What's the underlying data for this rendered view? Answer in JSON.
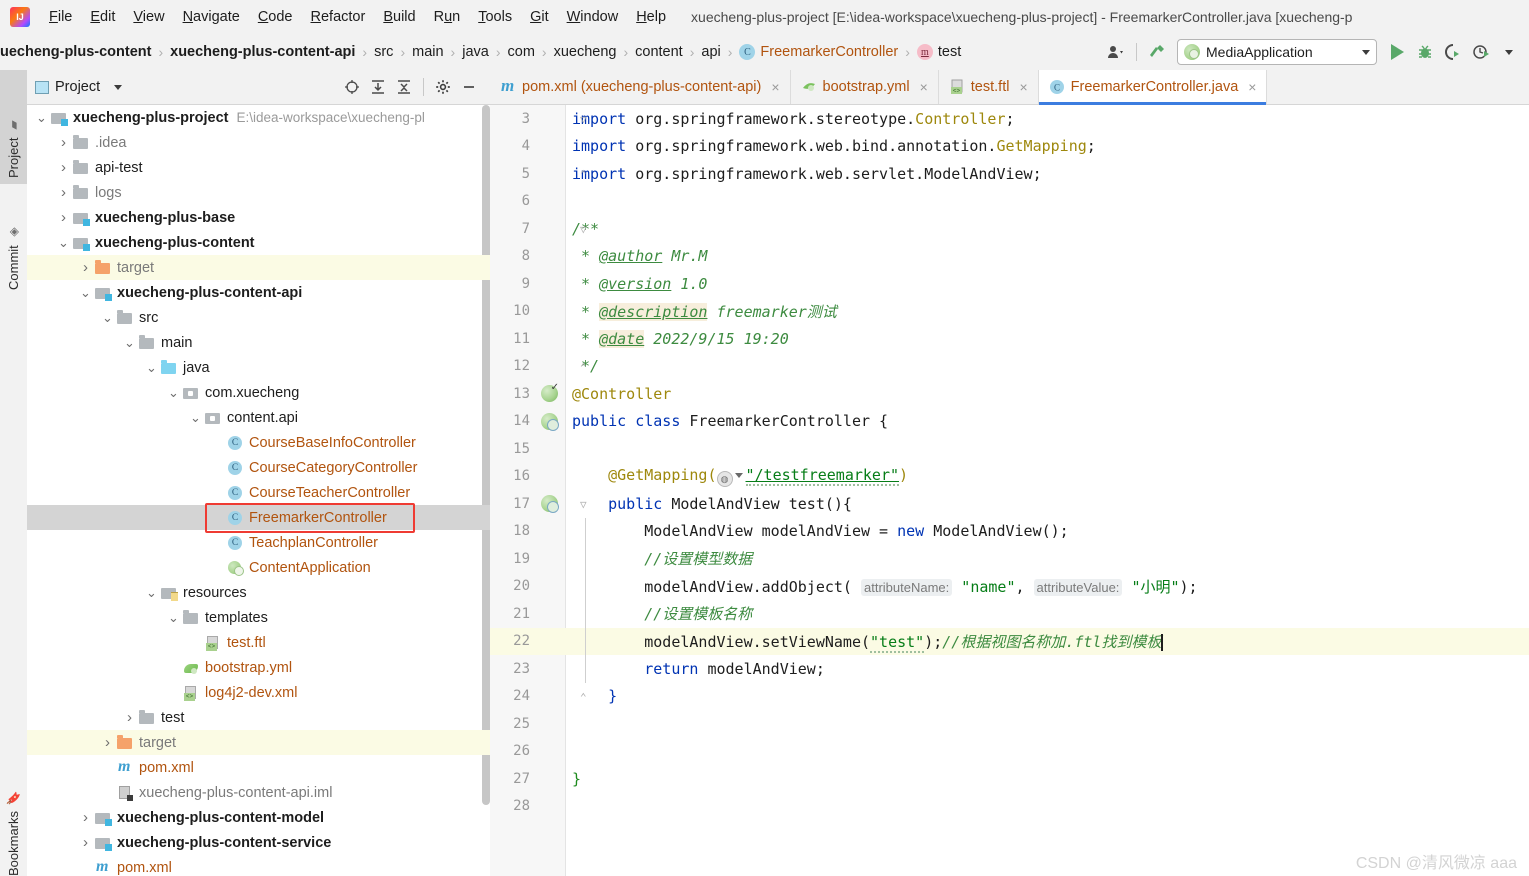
{
  "window": {
    "title": "xuecheng-plus-project [E:\\idea-workspace\\xuecheng-plus-project] - FreemarkerController.java [xuecheng-p",
    "logo_label": "intellij-idea-logo"
  },
  "menubar": {
    "items": [
      {
        "label": "File",
        "mnemonic": "F"
      },
      {
        "label": "Edit",
        "mnemonic": "E"
      },
      {
        "label": "View",
        "mnemonic": "V"
      },
      {
        "label": "Navigate",
        "mnemonic": "N"
      },
      {
        "label": "Code",
        "mnemonic": "C"
      },
      {
        "label": "Refactor",
        "mnemonic": "R"
      },
      {
        "label": "Build",
        "mnemonic": "B"
      },
      {
        "label": "Run",
        "mnemonic": "u"
      },
      {
        "label": "Tools",
        "mnemonic": "T"
      },
      {
        "label": "Git",
        "mnemonic": "G"
      },
      {
        "label": "Window",
        "mnemonic": "W"
      },
      {
        "label": "Help",
        "mnemonic": "H"
      }
    ]
  },
  "navbar": {
    "breadcrumbs": [
      {
        "label": "uecheng-plus-content",
        "bold": true,
        "icon": ""
      },
      {
        "label": "xuecheng-plus-content-api",
        "bold": true,
        "icon": ""
      },
      {
        "label": "src",
        "bold": false,
        "icon": ""
      },
      {
        "label": "main",
        "bold": false,
        "icon": ""
      },
      {
        "label": "java",
        "bold": false,
        "icon": ""
      },
      {
        "label": "com",
        "bold": false,
        "icon": ""
      },
      {
        "label": "xuecheng",
        "bold": false,
        "icon": ""
      },
      {
        "label": "content",
        "bold": false,
        "icon": ""
      },
      {
        "label": "api",
        "bold": false,
        "icon": ""
      },
      {
        "label": "FreemarkerController",
        "bold": false,
        "icon": "class-icon",
        "icon_letter": "C"
      },
      {
        "label": "test",
        "bold": false,
        "icon": "method-icon",
        "icon_letter": "m"
      }
    ],
    "separator": "›",
    "run_config": "MediaApplication",
    "buttons": [
      "user-icon",
      "hammer-icon",
      "run-icon",
      "debug-icon",
      "run-coverage-icon",
      "profile-icon"
    ]
  },
  "toolstrip": {
    "tabs": [
      {
        "label": "Project",
        "selected": true,
        "icon": "project-folder-icon"
      },
      {
        "label": "Commit",
        "selected": false,
        "icon": "commit-icon"
      },
      {
        "label": "Bookmarks",
        "selected": false,
        "icon": "bookmark-icon"
      }
    ]
  },
  "project_panel": {
    "title": "Project",
    "header_icons": [
      "locate-icon",
      "expand-all-icon",
      "collapse-all-icon",
      "settings-gear-icon",
      "hide-panel-icon"
    ],
    "tree": [
      {
        "depth": 0,
        "arrow": "down",
        "icon": "module",
        "label": "xuecheng-plus-project",
        "bold": true,
        "color": "dark",
        "path": "E:\\idea-workspace\\xuecheng-pl"
      },
      {
        "depth": 1,
        "arrow": "right",
        "icon": "folder",
        "label": ".idea",
        "bold": false,
        "color": "gray",
        "path": ""
      },
      {
        "depth": 1,
        "arrow": "right",
        "icon": "folder",
        "label": "api-test",
        "bold": false,
        "color": "dark",
        "path": ""
      },
      {
        "depth": 1,
        "arrow": "right",
        "icon": "folder",
        "label": "logs",
        "bold": false,
        "color": "gray",
        "path": ""
      },
      {
        "depth": 1,
        "arrow": "right",
        "icon": "module",
        "label": "xuecheng-plus-base",
        "bold": true,
        "color": "dark",
        "path": ""
      },
      {
        "depth": 1,
        "arrow": "down",
        "icon": "module",
        "label": "xuecheng-plus-content",
        "bold": true,
        "color": "dark",
        "path": ""
      },
      {
        "depth": 2,
        "arrow": "right",
        "icon": "forange",
        "label": "target",
        "bold": false,
        "color": "gray",
        "path": "",
        "hl": "yellow"
      },
      {
        "depth": 2,
        "arrow": "down",
        "icon": "module",
        "label": "xuecheng-plus-content-api",
        "bold": true,
        "color": "dark",
        "path": ""
      },
      {
        "depth": 3,
        "arrow": "down",
        "icon": "folder",
        "label": "src",
        "bold": false,
        "color": "dark",
        "path": ""
      },
      {
        "depth": 4,
        "arrow": "down",
        "icon": "folder",
        "label": "main",
        "bold": false,
        "color": "dark",
        "path": ""
      },
      {
        "depth": 5,
        "arrow": "down",
        "icon": "fblue",
        "label": "java",
        "bold": false,
        "color": "dark",
        "path": ""
      },
      {
        "depth": 6,
        "arrow": "down",
        "icon": "pkg",
        "label": "com.xuecheng",
        "bold": false,
        "color": "dark",
        "path": ""
      },
      {
        "depth": 7,
        "arrow": "down",
        "icon": "pkg",
        "label": "content.api",
        "bold": false,
        "color": "dark",
        "path": ""
      },
      {
        "depth": 8,
        "arrow": "none",
        "icon": "cls",
        "label": "CourseBaseInfoController",
        "bold": false,
        "color": "orange",
        "path": ""
      },
      {
        "depth": 8,
        "arrow": "none",
        "icon": "cls",
        "label": "CourseCategoryController",
        "bold": false,
        "color": "orange",
        "path": ""
      },
      {
        "depth": 8,
        "arrow": "none",
        "icon": "cls",
        "label": "CourseTeacherController",
        "bold": false,
        "color": "orange",
        "path": ""
      },
      {
        "depth": 8,
        "arrow": "none",
        "icon": "cls",
        "label": "FreemarkerController",
        "bold": false,
        "color": "orange",
        "path": "",
        "hl": "gray",
        "boxed": true
      },
      {
        "depth": 8,
        "arrow": "none",
        "icon": "cls",
        "label": "TeachplanController",
        "bold": false,
        "color": "orange",
        "path": ""
      },
      {
        "depth": 8,
        "arrow": "none",
        "icon": "spring",
        "label": "ContentApplication",
        "bold": false,
        "color": "orange",
        "path": ""
      },
      {
        "depth": 5,
        "arrow": "down",
        "icon": "fres",
        "label": "resources",
        "bold": false,
        "color": "dark",
        "path": ""
      },
      {
        "depth": 6,
        "arrow": "down",
        "icon": "folder",
        "label": "templates",
        "bold": false,
        "color": "dark",
        "path": ""
      },
      {
        "depth": 7,
        "arrow": "none",
        "icon": "ftl",
        "label": "test.ftl",
        "bold": false,
        "color": "orange",
        "path": ""
      },
      {
        "depth": 6,
        "arrow": "none",
        "icon": "yml",
        "label": "bootstrap.yml",
        "bold": false,
        "color": "orange",
        "path": ""
      },
      {
        "depth": 6,
        "arrow": "none",
        "icon": "ftl",
        "label": "log4j2-dev.xml",
        "bold": false,
        "color": "orange",
        "path": ""
      },
      {
        "depth": 4,
        "arrow": "right",
        "icon": "folder",
        "label": "test",
        "bold": false,
        "color": "dark",
        "path": ""
      },
      {
        "depth": 3,
        "arrow": "right",
        "icon": "forange",
        "label": "target",
        "bold": false,
        "color": "gray",
        "path": "",
        "hl": "yellow"
      },
      {
        "depth": 3,
        "arrow": "none",
        "icon": "maven",
        "label": "pom.xml",
        "bold": false,
        "color": "orange",
        "path": ""
      },
      {
        "depth": 3,
        "arrow": "none",
        "icon": "iml",
        "label": "xuecheng-plus-content-api.iml",
        "bold": false,
        "color": "gray",
        "path": ""
      },
      {
        "depth": 2,
        "arrow": "right",
        "icon": "module",
        "label": "xuecheng-plus-content-model",
        "bold": true,
        "color": "dark",
        "path": ""
      },
      {
        "depth": 2,
        "arrow": "right",
        "icon": "module",
        "label": "xuecheng-plus-content-service",
        "bold": true,
        "color": "dark",
        "path": ""
      },
      {
        "depth": 2,
        "arrow": "none",
        "icon": "maven",
        "label": "pom.xml",
        "bold": false,
        "color": "orange",
        "path": ""
      }
    ]
  },
  "editor": {
    "tabs": [
      {
        "label": "pom.xml (xuecheng-plus-content-api)",
        "icon": "maven-icon",
        "active": false,
        "close": "×"
      },
      {
        "label": "bootstrap.yml",
        "icon": "yaml-icon",
        "active": false,
        "close": "×"
      },
      {
        "label": "test.ftl",
        "icon": "ftl-icon",
        "active": false,
        "close": "×"
      },
      {
        "label": "FreemarkerController.java",
        "icon": "java-class-icon",
        "active": true,
        "close": "×"
      }
    ],
    "lines": [
      {
        "n": "3"
      },
      {
        "n": "4"
      },
      {
        "n": "5"
      },
      {
        "n": "6"
      },
      {
        "n": "7"
      },
      {
        "n": "8"
      },
      {
        "n": "9"
      },
      {
        "n": "10"
      },
      {
        "n": "11"
      },
      {
        "n": "12"
      },
      {
        "n": "13"
      },
      {
        "n": "14"
      },
      {
        "n": "15"
      },
      {
        "n": "16"
      },
      {
        "n": "17"
      },
      {
        "n": "18"
      },
      {
        "n": "19"
      },
      {
        "n": "20"
      },
      {
        "n": "21"
      },
      {
        "n": "22"
      },
      {
        "n": "23"
      },
      {
        "n": "24"
      },
      {
        "n": "25"
      },
      {
        "n": "26"
      },
      {
        "n": "27"
      },
      {
        "n": "28"
      }
    ],
    "code": {
      "l3_kw": "import",
      "l3_pkg": " org.springframework.stereotype.",
      "l3_cls": "Controller",
      "l3_end": ";",
      "l4_kw": "import",
      "l4_pkg": " org.springframework.web.bind.annotation.",
      "l4_cls": "GetMapping",
      "l4_end": ";",
      "l5_kw": "import",
      "l5_pkg": " org.springframework.web.servlet.ModelAndView",
      "l5_end": ";",
      "l7": "/**",
      "l8_star": " * ",
      "l8_tag": "@author",
      "l8_val": " Mr.M",
      "l9_star": " * ",
      "l9_tag": "@version",
      "l9_val": " 1.0",
      "l10_star": " * ",
      "l10_tag": "@description",
      "l10_val": " freemarker测试",
      "l11_star": " * ",
      "l11_tag": "@date",
      "l11_val": " 2022/9/15 19:20",
      "l12": " */",
      "l13": "@Controller",
      "l14_kw1": "public",
      "l14_kw2": " class",
      "l14_name": " FreemarkerController",
      "l14_brace": " {",
      "l16_ann": "@GetMapping(",
      "l16_str": "\"/testfreemarker\"",
      "l16_end": ")",
      "l17_kw": "public",
      "l17_type": " ModelAndView",
      "l17_name": " test",
      "l17_end": "(){",
      "l18_type": "ModelAndView modelAndView = ",
      "l18_kw": "new",
      "l18_rest": " ModelAndView();",
      "l19": "//设置模型数据",
      "l20_a": "modelAndView.addObject(",
      "l20_h1": "attributeName:",
      "l20_s1": "\"name\"",
      "l20_c": ", ",
      "l20_h2": "attributeValue:",
      "l20_s2": "\"小明\"",
      "l20_e": ");",
      "l21": "//设置模板名称",
      "l22_a": "modelAndView.setViewName(",
      "l22_s": "\"test\"",
      "l22_b": ");",
      "l22_c": "//根据视图名称加.ftl找到模板",
      "l23_kw": "return",
      "l23_rest": " modelAndView;",
      "l24": "}",
      "l27": "}"
    }
  },
  "watermark": "CSDN @清风微凉 aaa",
  "colors": {
    "accent_blue": "#3c7de0",
    "keyword": "#0033b3",
    "string": "#067d17",
    "annotation": "#9e880d",
    "comment": "#8c8c8c",
    "javadoc": "#3d8b40",
    "file_orange": "#b1540f",
    "highlight_yellow": "#fbfbe4",
    "selection_gray": "#d4d4d4",
    "red_box": "#ef3b33"
  }
}
